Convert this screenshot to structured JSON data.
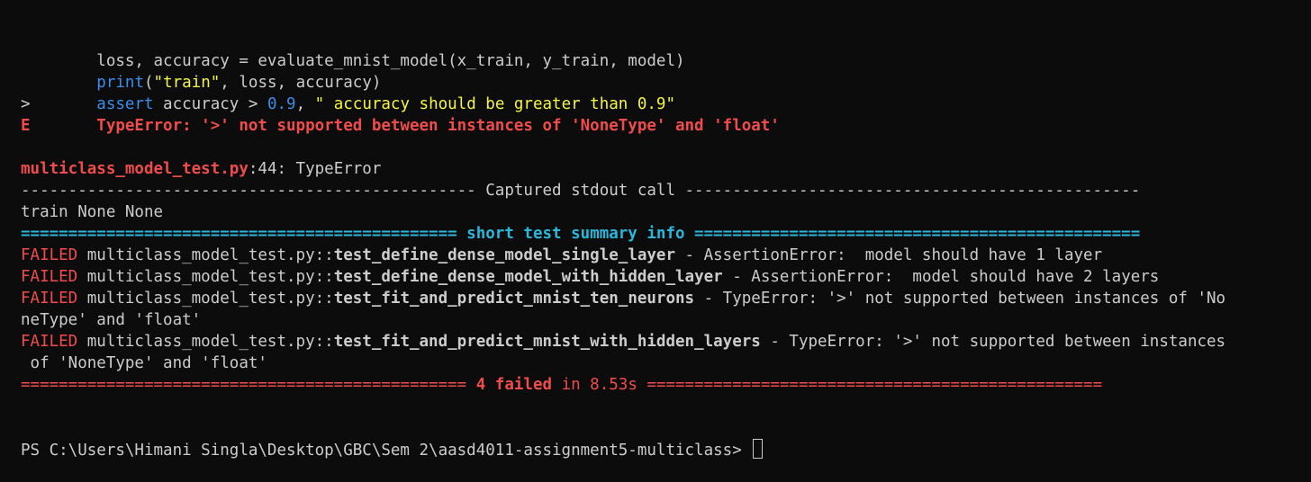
{
  "terminal": {
    "lines": [
      {
        "name": "code-line-evaluate",
        "segments": [
          {
            "text": "        loss, accuracy = evaluate_mnist_model(x_train, y_train, model)",
            "color": "default",
            "bold": false
          }
        ]
      },
      {
        "name": "code-line-print",
        "segments": [
          {
            "text": "        ",
            "color": "default",
            "bold": false
          },
          {
            "text": "print",
            "color": "blue",
            "bold": false
          },
          {
            "text": "(",
            "color": "default",
            "bold": false
          },
          {
            "text": "\"train\"",
            "color": "yellow",
            "bold": false
          },
          {
            "text": ", loss, accuracy)",
            "color": "default",
            "bold": false
          }
        ]
      },
      {
        "name": "code-line-assert",
        "segments": [
          {
            "text": ">       ",
            "color": "default",
            "bold": false
          },
          {
            "text": "assert",
            "color": "blue",
            "bold": false
          },
          {
            "text": " accuracy > ",
            "color": "default",
            "bold": false
          },
          {
            "text": "0.9",
            "color": "blue",
            "bold": false
          },
          {
            "text": ", ",
            "color": "default",
            "bold": false
          },
          {
            "text": "\" accuracy should be greater than 0.9\"",
            "color": "yellow",
            "bold": false
          }
        ]
      },
      {
        "name": "error-line",
        "segments": [
          {
            "text": "E       TypeError: '>' not supported between instances of 'NoneType' and 'float'",
            "color": "red",
            "bold": true
          }
        ]
      },
      {
        "name": "blank-line",
        "segments": [
          {
            "text": "",
            "color": "default",
            "bold": false
          }
        ]
      },
      {
        "name": "error-location-line",
        "segments": [
          {
            "text": "multiclass_model_test.py",
            "color": "red",
            "bold": true
          },
          {
            "text": ":44: TypeError",
            "color": "default",
            "bold": false
          }
        ]
      },
      {
        "name": "captured-stdout-header",
        "segments": [
          {
            "text": "------------------------------------------------ Captured stdout call ------------------------------------------------",
            "color": "default",
            "bold": false
          }
        ]
      },
      {
        "name": "stdout-output-line",
        "segments": [
          {
            "text": "train None None",
            "color": "default",
            "bold": false
          }
        ]
      },
      {
        "name": "summary-header",
        "segments": [
          {
            "text": "============================================== short test summary info ===============================================",
            "color": "cyan",
            "bold": true
          }
        ]
      },
      {
        "name": "failed-line-single-layer",
        "segments": [
          {
            "text": "FAILED",
            "color": "red",
            "bold": false
          },
          {
            "text": " multiclass_model_test.py::",
            "color": "default",
            "bold": false
          },
          {
            "text": "test_define_dense_model_single_layer",
            "color": "default",
            "bold": true
          },
          {
            "text": " - AssertionError:  model should have 1 layer",
            "color": "default",
            "bold": false
          }
        ]
      },
      {
        "name": "failed-line-hidden-layer",
        "segments": [
          {
            "text": "FAILED",
            "color": "red",
            "bold": false
          },
          {
            "text": " multiclass_model_test.py::",
            "color": "default",
            "bold": false
          },
          {
            "text": "test_define_dense_model_with_hidden_layer",
            "color": "default",
            "bold": true
          },
          {
            "text": " - AssertionError:  model should have 2 layers",
            "color": "default",
            "bold": false
          }
        ]
      },
      {
        "name": "failed-line-ten-neurons",
        "segments": [
          {
            "text": "FAILED",
            "color": "red",
            "bold": false
          },
          {
            "text": " multiclass_model_test.py::",
            "color": "default",
            "bold": false
          },
          {
            "text": "test_fit_and_predict_mnist_ten_neurons",
            "color": "default",
            "bold": true
          },
          {
            "text": " - TypeError: '>' not supported between instances of 'No",
            "color": "default",
            "bold": false
          }
        ]
      },
      {
        "name": "failed-line-ten-neurons-wrap",
        "segments": [
          {
            "text": "neType' and 'float'",
            "color": "default",
            "bold": false
          }
        ]
      },
      {
        "name": "failed-line-hidden-layers",
        "segments": [
          {
            "text": "FAILED",
            "color": "red",
            "bold": false
          },
          {
            "text": " multiclass_model_test.py::",
            "color": "default",
            "bold": false
          },
          {
            "text": "test_fit_and_predict_mnist_with_hidden_layers",
            "color": "default",
            "bold": true
          },
          {
            "text": " - TypeError: '>' not supported between instances",
            "color": "default",
            "bold": false
          }
        ]
      },
      {
        "name": "failed-line-hidden-layers-wrap",
        "segments": [
          {
            "text": " of 'NoneType' and 'float'",
            "color": "default",
            "bold": false
          }
        ]
      },
      {
        "name": "result-summary-line",
        "segments": [
          {
            "text": "=============================================== ",
            "color": "red",
            "bold": false
          },
          {
            "text": "4 failed",
            "color": "red",
            "bold": true
          },
          {
            "text": " in 8.53s",
            "color": "red",
            "bold": false
          },
          {
            "text": " ================================================",
            "color": "red",
            "bold": false
          }
        ]
      }
    ],
    "prompt": {
      "text": "PS C:\\Users\\Himani Singla\\Desktop\\GBC\\Sem 2\\aasd4011-assignment5-multiclass> ",
      "input_value": ""
    }
  },
  "colors": {
    "background": "#0c0c0c",
    "default": "#cccccc",
    "blue": "#3b8eea",
    "yellow": "#f5f543",
    "red": "#f14c4c",
    "cyan": "#29b8db"
  }
}
